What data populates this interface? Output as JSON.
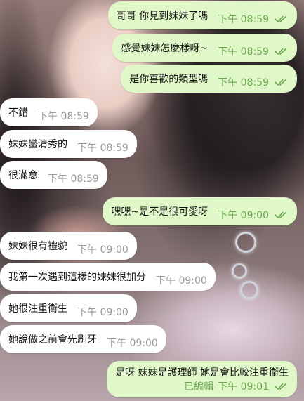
{
  "colors": {
    "outgoing_bubble": "#e0f7c8",
    "incoming_bubble": "#ffffff",
    "outgoing_meta": "#6aa84f",
    "incoming_meta": "#9a9a9a"
  },
  "messages": [
    {
      "direction": "out",
      "text": "哥哥 你見到妹妹了嗎",
      "time": "下午 08:59",
      "status": "read-double-check-icon"
    },
    {
      "direction": "out",
      "text": "感覺妹妹怎麼樣呀~",
      "time": "下午 08:59",
      "status": "read-double-check-icon"
    },
    {
      "direction": "out",
      "text": "是你喜歡的類型嗎",
      "time": "下午 08:59",
      "status": "read-double-check-icon"
    },
    {
      "direction": "in",
      "text": "不錯",
      "time": "下午 08:59"
    },
    {
      "direction": "in",
      "text": "妹妹蠻清秀的",
      "time": "下午 08:59"
    },
    {
      "direction": "in",
      "text": "很滿意",
      "time": "下午 08:59"
    },
    {
      "direction": "out",
      "text": "嘿嘿~是不是很可愛呀",
      "time": "下午 09:00",
      "status": "read-double-check-icon"
    },
    {
      "direction": "in",
      "text": "妹妹很有禮貌",
      "time": "下午 09:00"
    },
    {
      "direction": "in",
      "text": "我第一次遇到這樣的妹妹很加分",
      "time": "下午 09:00"
    },
    {
      "direction": "in",
      "text": "她很注重衛生",
      "time": "下午 09:00"
    },
    {
      "direction": "in",
      "text": "她說做之前會先刷牙",
      "time": "下午 09:00"
    },
    {
      "direction": "out",
      "text": "是呀 妹妹是護理師 她是會比較注重衛生",
      "edited": "已編輯",
      "time": "下午 09:01",
      "status": "read-double-check-icon"
    }
  ]
}
